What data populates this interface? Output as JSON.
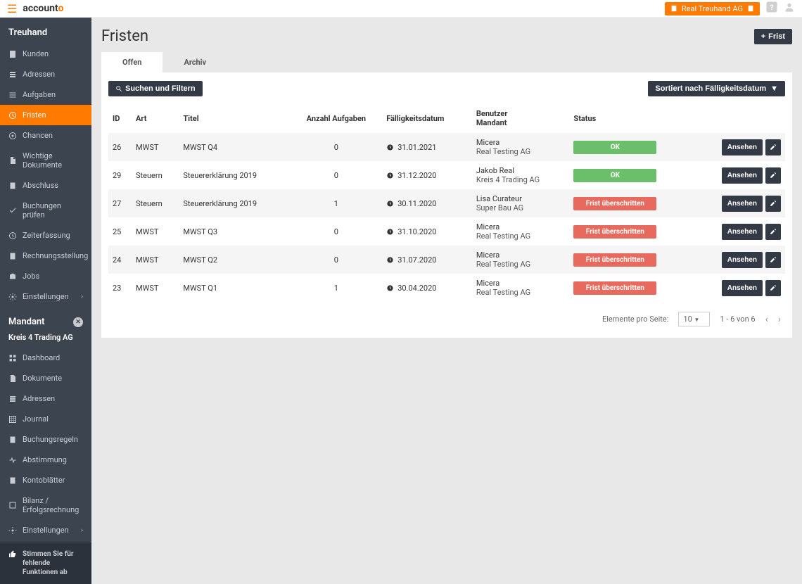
{
  "topbar": {
    "logo": {
      "part1": "account",
      "part2": "o"
    },
    "org": "Real Treuhand AG"
  },
  "sidebar": {
    "section1": "Treuhand",
    "items1": [
      {
        "label": "Kunden"
      },
      {
        "label": "Adressen"
      },
      {
        "label": "Aufgaben"
      },
      {
        "label": "Fristen"
      },
      {
        "label": "Chancen"
      },
      {
        "label": "Wichtige Dokumente"
      },
      {
        "label": "Abschluss"
      },
      {
        "label": "Buchungen prüfen"
      },
      {
        "label": "Zeiterfassung"
      },
      {
        "label": "Rechnungsstellung"
      },
      {
        "label": "Jobs"
      },
      {
        "label": "Einstellungen"
      }
    ],
    "section2": "Mandant",
    "mandant": "Kreis 4 Trading AG",
    "items2": [
      {
        "label": "Dashboard"
      },
      {
        "label": "Dokumente"
      },
      {
        "label": "Adressen"
      },
      {
        "label": "Journal"
      },
      {
        "label": "Buchungsregeln"
      },
      {
        "label": "Abstimmung"
      },
      {
        "label": "Kontoblätter"
      },
      {
        "label": "Bilanz / Erfolgsrechnung"
      },
      {
        "label": "Einstellungen"
      }
    ],
    "vote": "Stimmen Sie für fehlende Funktionen ab"
  },
  "page": {
    "title": "Fristen",
    "addBtn": "Frist",
    "tabs": {
      "open": "Offen",
      "archive": "Archiv"
    },
    "searchBtn": "Suchen und Filtern",
    "sortBtn": "Sortiert nach Fälligkeitsdatum",
    "columns": {
      "id": "ID",
      "art": "Art",
      "titel": "Titel",
      "anzahl": "Anzahl Aufgaben",
      "datum": "Fälligkeitsdatum",
      "benutzer1": "Benutzer",
      "benutzer2": "Mandant",
      "status": "Status"
    },
    "viewBtn": "Ansehen",
    "status": {
      "ok": "OK",
      "overdue": "Frist überschritten"
    },
    "rows": [
      {
        "id": "26",
        "art": "MWST",
        "titel": "MWST Q4",
        "anzahl": "0",
        "datum": "31.01.2021",
        "user": "Micera",
        "mandant": "Real Testing AG",
        "status": "ok"
      },
      {
        "id": "29",
        "art": "Steuern",
        "titel": "Steuererklärung 2019",
        "anzahl": "0",
        "datum": "31.12.2020",
        "user": "Jakob Real",
        "mandant": "Kreis 4 Trading AG",
        "status": "ok"
      },
      {
        "id": "27",
        "art": "Steuern",
        "titel": "Steuererklärung 2019",
        "anzahl": "1",
        "datum": "30.11.2020",
        "user": "Lisa Curateur",
        "mandant": "Super Bau AG",
        "status": "overdue"
      },
      {
        "id": "25",
        "art": "MWST",
        "titel": "MWST Q3",
        "anzahl": "0",
        "datum": "31.10.2020",
        "user": "Micera",
        "mandant": "Real Testing AG",
        "status": "overdue"
      },
      {
        "id": "24",
        "art": "MWST",
        "titel": "MWST Q2",
        "anzahl": "0",
        "datum": "31.07.2020",
        "user": "Micera",
        "mandant": "Real Testing AG",
        "status": "overdue"
      },
      {
        "id": "23",
        "art": "MWST",
        "titel": "MWST Q1",
        "anzahl": "1",
        "datum": "30.04.2020",
        "user": "Micera",
        "mandant": "Real Testing AG",
        "status": "overdue"
      }
    ],
    "pagination": {
      "label": "Elemente pro Seite:",
      "size": "10",
      "range": "1 - 6 von 6"
    }
  }
}
